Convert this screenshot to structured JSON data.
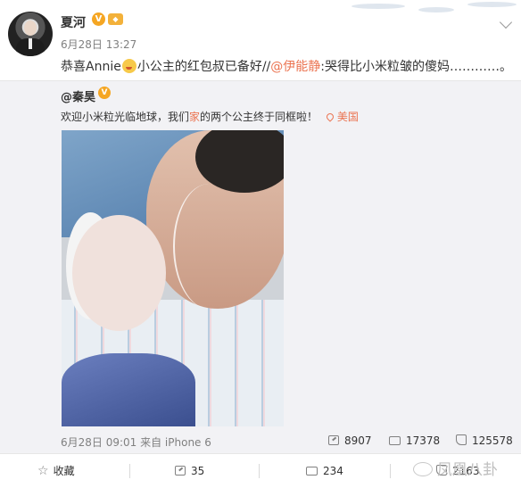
{
  "post": {
    "author": "夏河",
    "time": "6月28日 13:27",
    "text_before": "恭喜Annie",
    "text_mid": "小公主的红包叔已备好//",
    "mention": "@伊能静",
    "text_after": ":哭得比小米粒皱的傻妈…………。"
  },
  "repost": {
    "author": "@秦昊",
    "text_before": "欢迎小米粒光临地球，我们",
    "text_highlight": "家",
    "text_after": "的两个公主终于同框啦！",
    "location": "美国",
    "time_source": "6月28日 09:01 来自 iPhone 6",
    "reposts": "8907",
    "comments": "17378",
    "likes": "125578"
  },
  "actions": {
    "favorite": "收藏",
    "repost": "35",
    "comment": "234",
    "like": "2163"
  },
  "watermark": "凤凰八卦",
  "colors": {
    "accent_orange": "#eb7350",
    "badge_gold": "#f5a623",
    "card_background": "#f2f2f5"
  },
  "icons": [
    "avatar",
    "verified-badge",
    "level-badge",
    "chevron-down-icon",
    "emoji-icon",
    "location-pin-icon",
    "repost-icon",
    "comment-icon",
    "like-icon",
    "star-icon",
    "phoenix-logo-icon"
  ]
}
